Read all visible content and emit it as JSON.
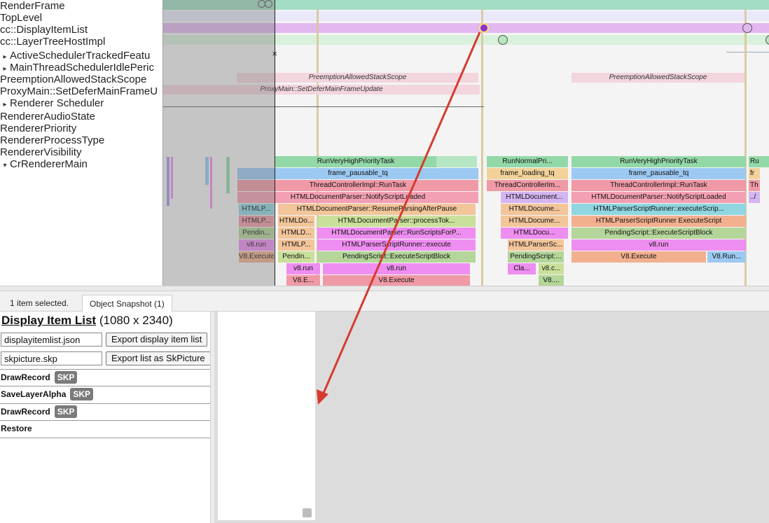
{
  "tracks": {
    "labels": [
      {
        "text": "RenderFrame",
        "expander": ""
      },
      {
        "text": "TopLevel",
        "expander": ""
      },
      {
        "text": "cc::DisplayItemList",
        "expander": ""
      },
      {
        "text": "cc::LayerTreeHostImpl",
        "expander": ""
      },
      {
        "text": "ActiveSchedulerTrackedFeatu",
        "expander": "▸"
      },
      {
        "text": "MainThreadSchedulerIdlePeric",
        "expander": "▸"
      },
      {
        "text": "PreemptionAllowedStackScope",
        "expander": ""
      },
      {
        "text": "ProxyMain::SetDeferMainFrameU",
        "expander": ""
      },
      {
        "text": "Renderer Scheduler",
        "expander": "▸"
      },
      {
        "text": "RendererAudioState",
        "expander": ""
      },
      {
        "text": "RendererPriority",
        "expander": ""
      },
      {
        "text": "RendererProcessType",
        "expander": ""
      },
      {
        "text": "RendererVisibility",
        "expander": ""
      },
      {
        "text": "CrRendererMain",
        "expander": "▾"
      }
    ]
  },
  "timeline": {
    "pink_slices": [
      {
        "text": "PreemptionAllowedStackScope"
      },
      {
        "text": "PreemptionAllowedStackScope"
      },
      {
        "text": "ProxyMain::SetDeferMainFrameUpdate"
      }
    ],
    "flame": [
      {
        "text": "RunVeryHighPriorityTask",
        "color": "#93d9a8"
      },
      {
        "text": "RunNormalPri...",
        "color": "#93d9a8"
      },
      {
        "text": "RunVeryHighPriorityTask",
        "color": "#93d9a8"
      },
      {
        "text": "Ru",
        "color": "#93d9a8"
      },
      {
        "text": "frame_pausable_tq",
        "color": "#9cc9f2"
      },
      {
        "text": "frame_loading_tq",
        "color": "#f2d29a"
      },
      {
        "text": "frame_pausable_tq",
        "color": "#9cc9f2"
      },
      {
        "text": "fr",
        "color": "#f2d29a"
      },
      {
        "text": "ThreadControllerImpl::RunTask",
        "color": "#ef9aa6"
      },
      {
        "text": "ThreadControllerIm...",
        "color": "#ef9aa6"
      },
      {
        "text": "ThreadControllerImpl::RunTask",
        "color": "#ef9aa6"
      },
      {
        "text": "Th",
        "color": "#ef9aa6"
      },
      {
        "text": "HTMLDocumentParser::NotifyScriptLoaded",
        "color": "#f3a0b4"
      },
      {
        "text": "HTMLDocument...",
        "color": "#d4b5f2"
      },
      {
        "text": "HTMLDocumentParser::NotifyScriptLoaded",
        "color": "#f3a0b4"
      },
      {
        "text": "../",
        "color": "#d4b5f2"
      },
      {
        "text": "HTMLP...",
        "color": "#8fd6e0"
      },
      {
        "text": "HTMLDocumentParser::ResumeParsingAfterPause",
        "color": "#f2c59a"
      },
      {
        "text": "HTMLDocume...",
        "color": "#f2c59a"
      },
      {
        "text": "HTMLParserScriptRunner::executeScrip...",
        "color": "#8fd6e0"
      },
      {
        "text": "HTMLP...",
        "color": "#ef9aa6"
      },
      {
        "text": "HTMLDo...",
        "color": "#f2c59a"
      },
      {
        "text": "HTMLDocumentParser::processTok...",
        "color": "#c9e09a"
      },
      {
        "text": "HTMLDocume...",
        "color": "#f2c59a"
      },
      {
        "text": "HTMLParserScriptRunner ExecuteScript",
        "color": "#f2b08f"
      },
      {
        "text": "Pendin...",
        "color": "#b4d69a"
      },
      {
        "text": "HTMLD...",
        "color": "#f2c59a"
      },
      {
        "text": "HTMLDocumentParser::RunScriptsForP...",
        "color": "#ee8ef0"
      },
      {
        "text": "HTMLDocu...",
        "color": "#ee8ef0"
      },
      {
        "text": "PendingScript::ExecuteScriptBlock",
        "color": "#b4d69a"
      },
      {
        "text": "v8.run",
        "color": "#ee8ef0"
      },
      {
        "text": "HTMLP...",
        "color": "#f2c59a"
      },
      {
        "text": "HTMLParserScriptRunner::execute",
        "color": "#ee8ef0"
      },
      {
        "text": "HTMLParserSc...",
        "color": "#f2c59a"
      },
      {
        "text": "v8.run",
        "color": "#ee8ef0"
      },
      {
        "text": "V8.Execute",
        "color": "#f2b08f"
      },
      {
        "text": "Pendin...",
        "color": "#c9e09a"
      },
      {
        "text": "PendingScript::ExecuteScriptBlock",
        "color": "#b4d69a"
      },
      {
        "text": "PendingScript:...",
        "color": "#b4d69a"
      },
      {
        "text": "V8.Execute",
        "color": "#f2b08f"
      },
      {
        "text": "V8.Run...",
        "color": "#9cc9f2"
      },
      {
        "text": "v8.run",
        "color": "#ee8ef0"
      },
      {
        "text": "v8.run",
        "color": "#ee8ef0"
      },
      {
        "text": "Cla...",
        "color": "#ee8ef0"
      },
      {
        "text": "v8.c...",
        "color": "#c9e09a"
      },
      {
        "text": "V8.E...",
        "color": "#ef9aa6"
      },
      {
        "text": "V8.Execute",
        "color": "#ef9aa6"
      },
      {
        "text": "V8....",
        "color": "#b4d69a"
      }
    ]
  },
  "tabs": {
    "selection_status": "1 item selected.",
    "active_tab": "Object Snapshot (1)"
  },
  "snapshot": {
    "title": "Display Item List",
    "dimensions": "(1080 x 2340)",
    "json_file": "displayitemlist.json",
    "export_json_label": "Export display item list",
    "skp_file": "skpicture.skp",
    "export_skp_label": "Export list as SkPicture",
    "ops": [
      {
        "name": "DrawRecord",
        "badge": "SKP"
      },
      {
        "name": "SaveLayerAlpha",
        "badge": "SKP"
      },
      {
        "name": "DrawRecord",
        "badge": "SKP"
      },
      {
        "name": "Restore",
        "badge": ""
      }
    ]
  },
  "colors": {
    "annotation_arrow": "#d63b2f",
    "selected_marker": "#8e2fd0"
  }
}
